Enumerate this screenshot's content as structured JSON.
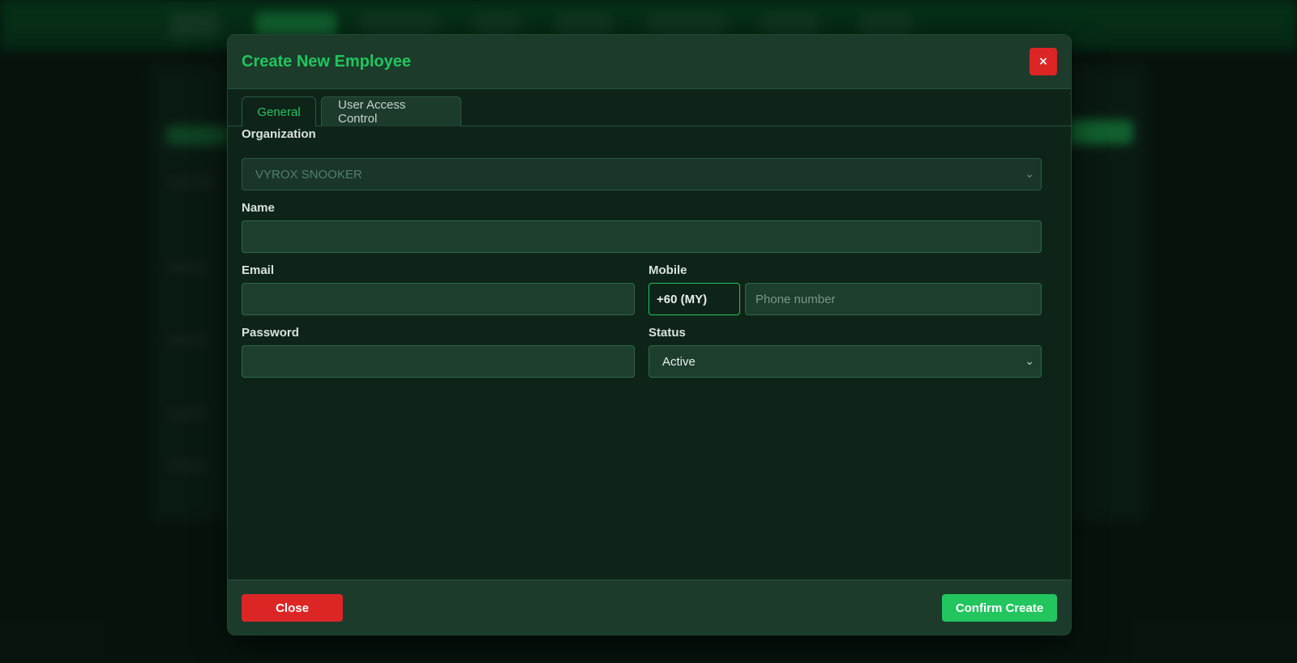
{
  "modal": {
    "title": "Create New Employee",
    "close_icon": "×",
    "tabs": [
      {
        "label": "General",
        "active": true
      },
      {
        "label": "User Access Control",
        "active": false
      }
    ]
  },
  "form": {
    "organization": {
      "label": "Organization",
      "value": "VYROX SNOOKER",
      "disabled": true
    },
    "name": {
      "label": "Name",
      "value": ""
    },
    "email": {
      "label": "Email",
      "value": ""
    },
    "mobile": {
      "label": "Mobile",
      "country_code": "+60 (MY)",
      "placeholder": "Phone number",
      "value": ""
    },
    "password": {
      "label": "Password",
      "value": ""
    },
    "status": {
      "label": "Status",
      "value": "Active"
    }
  },
  "footer": {
    "close_label": "Close",
    "confirm_label": "Confirm Create"
  },
  "colors": {
    "accent": "#22c55e",
    "danger": "#dc2626",
    "modal_bg": "#0f2419",
    "header_bg": "#1c3b2b"
  },
  "icons": {
    "select_chevron": "chevron-down-icon",
    "close": "close-icon"
  }
}
